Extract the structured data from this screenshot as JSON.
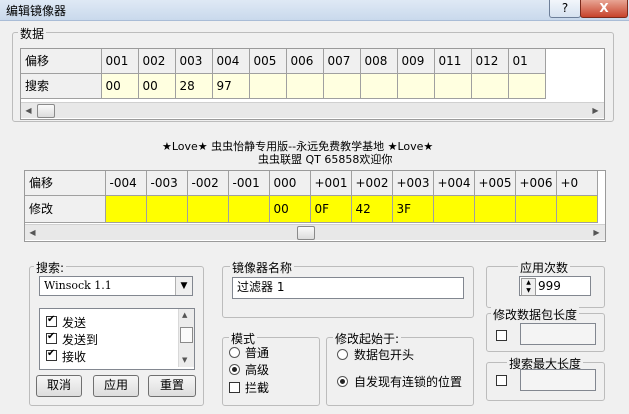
{
  "window": {
    "title": "编辑镜像器",
    "help": "?",
    "close": "X"
  },
  "data_group": {
    "label": "数据"
  },
  "top_grid": {
    "row_header": "偏移",
    "row2_header": "搜索",
    "columns": [
      "001",
      "002",
      "003",
      "004",
      "005",
      "006",
      "007",
      "008",
      "009",
      "011",
      "012",
      "01"
    ],
    "search_values": [
      "00",
      "00",
      "28",
      "97",
      "",
      "",
      "",
      "",
      "",
      "",
      "",
      ""
    ]
  },
  "banner": {
    "line1": "★Love★  虫虫怡静专用版--永远免费教学基地 ★Love★",
    "line2": "虫虫联盟 QT 65858欢迎你"
  },
  "bottom_grid": {
    "row_header": "偏移",
    "row2_header": "修改",
    "columns": [
      "-004",
      "-003",
      "-002",
      "-001",
      "000",
      "+001",
      "+002",
      "+003",
      "+004",
      "+005",
      "+006",
      "+0"
    ],
    "modify_values": [
      "",
      "",
      "",
      "",
      "00",
      "0F",
      "42",
      "3F",
      "",
      "",
      "",
      ""
    ],
    "highlight_color": "#ffff00"
  },
  "search_group": {
    "label": "搜索:",
    "select_value": "Winsock 1.1",
    "items": [
      {
        "label": "发送",
        "checked": true
      },
      {
        "label": "发送到",
        "checked": true
      },
      {
        "label": "接收",
        "checked": true
      }
    ],
    "cancel": "取消",
    "apply": "应用",
    "reset": "重置"
  },
  "mirror_name": {
    "label": "镜像器名称",
    "value": "过滤器 1"
  },
  "apply_count": {
    "label": "应用次数",
    "value": "999"
  },
  "mode_group": {
    "label": "模式",
    "normal": "普通",
    "advanced": "高级",
    "intercept": "拦截"
  },
  "modify_start": {
    "label": "修改起始于:",
    "opt1": "数据包开头",
    "opt2": "自发现有连锁的位置"
  },
  "modify_len": {
    "label": "修改数据包长度"
  },
  "search_max": {
    "label": "搜索最大长度"
  }
}
